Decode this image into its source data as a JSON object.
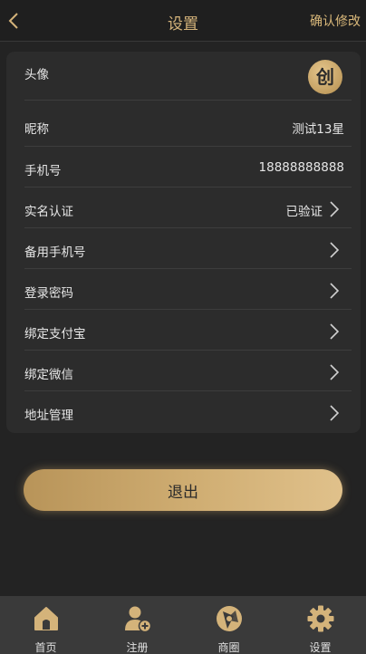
{
  "header": {
    "title": "设置",
    "confirm_label": "确认修改"
  },
  "settings": {
    "avatar": {
      "label": "头像",
      "logo_char": "创"
    },
    "nickname": {
      "label": "昵称",
      "value": "测试13星"
    },
    "phone": {
      "label": "手机号",
      "value": "18888888888"
    },
    "real_name": {
      "label": "实名认证",
      "value": "已验证"
    },
    "backup_phone": {
      "label": "备用手机号"
    },
    "login_password": {
      "label": "登录密码"
    },
    "alipay": {
      "label": "绑定支付宝"
    },
    "wechat": {
      "label": "绑定微信"
    },
    "address": {
      "label": "地址管理"
    }
  },
  "logout_label": "退出",
  "tabbar": {
    "items": [
      {
        "label": "首页",
        "icon": "home-icon"
      },
      {
        "label": "注册",
        "icon": "add-user-icon"
      },
      {
        "label": "商圈",
        "icon": "aperture-icon"
      },
      {
        "label": "设置",
        "icon": "gear-icon"
      }
    ]
  },
  "colors": {
    "accent": "#d4b37a",
    "background": "#232323",
    "card": "#2c2c2c",
    "tabbar": "#3a3a3a"
  }
}
